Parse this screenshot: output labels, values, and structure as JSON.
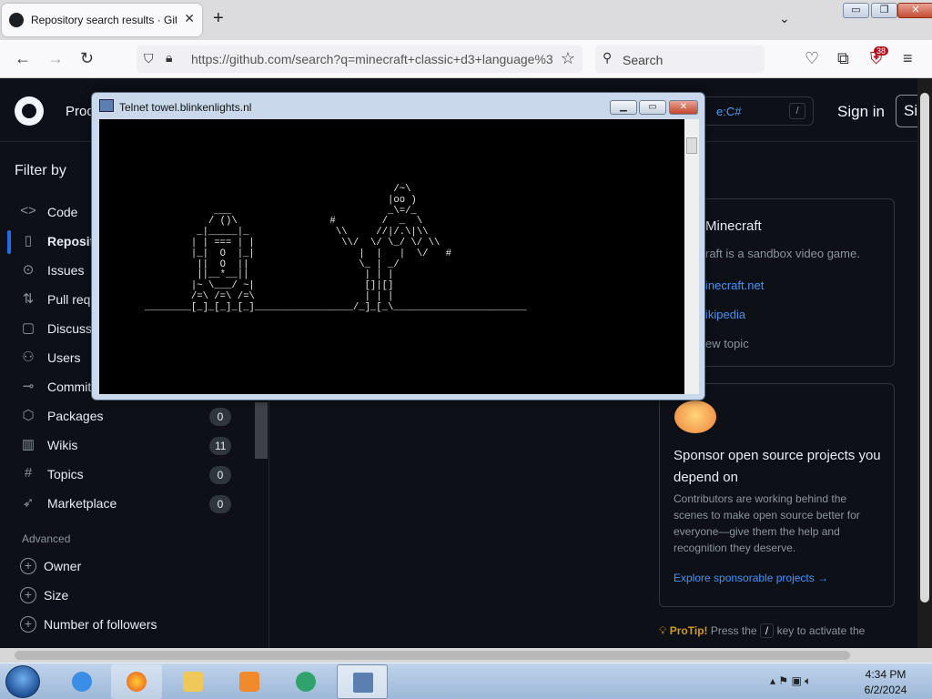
{
  "browser": {
    "tab_title": "Repository search results · GitHub",
    "new_tab": "+",
    "url": "https://github.com/search?q=minecraft+classic+d3+language%3",
    "search_placeholder": "Search",
    "extensions_badge": "38"
  },
  "github": {
    "header": {
      "product": "Product",
      "search_text": "e:C#",
      "search_kbd": "/",
      "sign_in": "Sign in",
      "sign_up": "Si"
    },
    "filter_title": "Filter by",
    "filters": [
      {
        "label": "Code",
        "icon": "code-icon",
        "count": ""
      },
      {
        "label": "Repositories",
        "icon": "repo-icon",
        "count": ""
      },
      {
        "label": "Issues",
        "icon": "issue-icon",
        "count": ""
      },
      {
        "label": "Pull requests",
        "icon": "pull-request-icon",
        "count": ""
      },
      {
        "label": "Discussions",
        "icon": "discussion-icon",
        "count": ""
      },
      {
        "label": "Users",
        "icon": "people-icon",
        "count": ""
      },
      {
        "label": "Commits",
        "icon": "commit-icon",
        "count": ""
      },
      {
        "label": "Packages",
        "icon": "package-icon",
        "count": "0"
      },
      {
        "label": "Wikis",
        "icon": "book-icon",
        "count": "11"
      },
      {
        "label": "Topics",
        "icon": "hash-icon",
        "count": "0"
      },
      {
        "label": "Marketplace",
        "icon": "rocket-icon",
        "count": "0"
      }
    ],
    "advanced_title": "Advanced",
    "advanced": [
      "Owner",
      "Size",
      "Number of followers"
    ],
    "topic": {
      "name": "Minecraft",
      "description": "raft is a sandbox video game.",
      "link1": "inecraft.net",
      "link2": "ikipedia",
      "link3": "ew topic"
    },
    "sponsor": {
      "title": "Sponsor open source projects you depend on",
      "text": "Contributors are working behind the scenes to make open source better for everyone—give them the help and recognition they deserve.",
      "link": "Explore sponsorable projects"
    },
    "protip": {
      "label": "ProTip!",
      "pre": " Press the ",
      "key": "/",
      "post": " key to activate the"
    }
  },
  "telnet": {
    "title": "Telnet towel.blinkenlights.nl",
    "ascii_art": "                                           /~\\\n                                          |oo )\n            ___                           _\\=/_\n           / ()\\                #        /  _  \\\n         _|_____|_               \\\\     //|/.\\|\\\\\n        | | === | |               \\\\/  \\/ \\_/ \\/ \\\\\n        |_|  O  |_|                  |  |   |  \\/   #\n         ||  O  ||                   \\_ | _/\n         ||__*__||                    | | |\n        |~ \\___/ ~|                   []|[]\n        /=\\ /=\\ /=\\                   | | |\n________[_]_[_]_[_]_________________/_]_[_\\_______________________"
  },
  "taskbar": {
    "clock_time": "4:34 PM",
    "clock_date": "6/2/2024"
  }
}
